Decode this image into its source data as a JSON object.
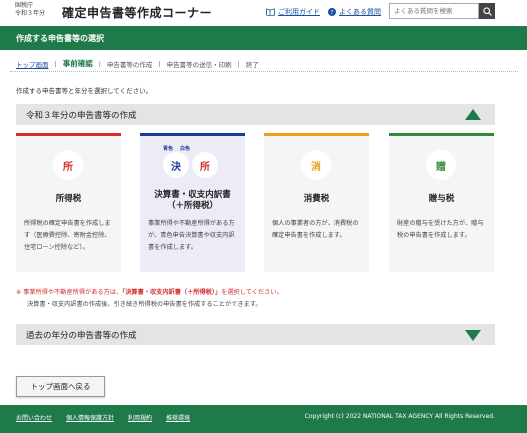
{
  "header": {
    "agency_line1": "国税庁",
    "agency_line2": "令和３年分",
    "site_title": "確定申告書等作成コーナー",
    "guide_label": "ご利用ガイド",
    "faq_label": "よくある質問",
    "search_placeholder": "よくある質問を検索"
  },
  "greenbar": {
    "title": "作成する申告書等の選択"
  },
  "breadcrumb": {
    "home": "トップ画面",
    "current": "事前確認",
    "step3": "申告書等の作成",
    "step4": "申告書等の送信・印刷",
    "step5": "終了"
  },
  "intro": "作成する申告書等と年分を選択してください。",
  "section1": {
    "title": "令和３年分の申告書等の作成"
  },
  "cards": [
    {
      "icon": "所",
      "title": "所得税",
      "desc": "所得税の確定申告書を作成します（医療費控除、寄附金控除、住宅ローン控除など）。"
    },
    {
      "icon_a": "決",
      "icon_b": "所",
      "mini_a": "青色",
      "mini_b": "白色",
      "title": "決算書・収支内訳書（＋所得税）",
      "desc": "事業所得や不動産所得がある方が、青色申告決算書や収支内訳書を作成します。"
    },
    {
      "icon": "消",
      "title": "消費税",
      "desc": "個人の事業者の方が、消費税の確定申告書を作成します。"
    },
    {
      "icon": "贈",
      "title": "贈与税",
      "desc": "財産の贈与を受けた方が、贈与税の申告書を作成します。"
    }
  ],
  "note": {
    "line1_a": "※ 事業所得や不動産所得がある方は、",
    "line1_b": "「決算書・収支内訳書（＋所得税）」",
    "line1_c": "を選択してください。",
    "line2": "決算書・収支内訳書の作成後、引き続き所得税の申告書を作成することができます。"
  },
  "section2": {
    "title": "過去の年分の申告書等の作成"
  },
  "back_button": "トップ画面へ戻る",
  "footer": {
    "links": [
      "お問い合わせ",
      "個人情報保護方針",
      "利用規約",
      "推奨環境"
    ],
    "copyright": "Copyright (c) 2022 NATIONAL TAX AGENCY All Rights Reserved."
  },
  "colors": {
    "brand_green": "#1f7a4a",
    "income_red": "#d32f2f",
    "business_blue": "#1a3c9c",
    "consumption_orange": "#e6a117",
    "gift_green": "#2e8b3a"
  }
}
